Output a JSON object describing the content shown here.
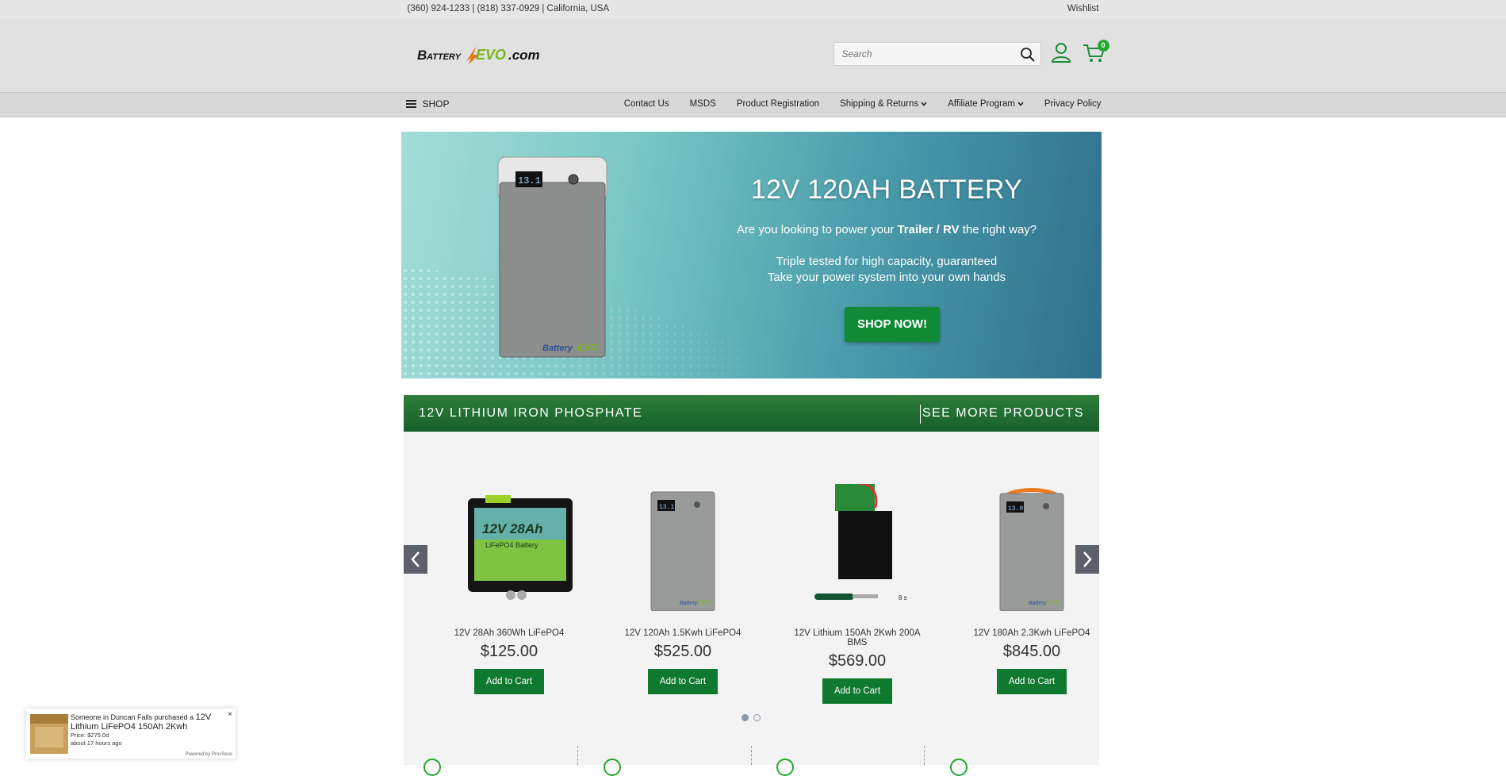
{
  "topbar": {
    "contact": "(360) 924-1233 | (818) 337-0929 | California, USA",
    "wishlist": "Wishlist"
  },
  "header": {
    "logo_text": "BatteryEVO.com",
    "search_placeholder": "Search",
    "cart_count": "0"
  },
  "nav": {
    "shop": "SHOP",
    "links": [
      "Contact Us",
      "MSDS",
      "Product Registration",
      "Shipping & Returns",
      "Affiliate Program",
      "Privacy Policy"
    ]
  },
  "hero": {
    "title": "12V 120AH BATTERY",
    "question_pre": "Are you looking to power your ",
    "question_bold": "Trailer / RV",
    "question_post": " the right way?",
    "line1": "Triple tested for high capacity, guaranteed",
    "line2": "Take your power system into your own hands",
    "button": "SHOP NOW!",
    "display": "13.1"
  },
  "section": {
    "title": "12V LITHIUM IRON PHOSPHATE",
    "more": "SEE MORE PRODUCTS"
  },
  "products": [
    {
      "name": "12V 28Ah 360Wh LiFePO4",
      "price": "$125.00",
      "button": "Add to Cart"
    },
    {
      "name": "12V 120Ah 1.5Kwh LiFePO4",
      "price": "$525.00",
      "button": "Add to Cart"
    },
    {
      "name": "12V Lithium 150Ah 2Kwh 200A BMS",
      "price": "$569.00",
      "button": "Add to Cart"
    },
    {
      "name": "12V 180Ah 2.3Kwh LiFePO4",
      "price": "$845.00",
      "button": "Add to Cart"
    }
  ],
  "popup": {
    "intro": "Someone in Duncan Falls purchased a ",
    "product": "12V Lithium LiFePO4 150Ah 2Kwh",
    "price": "Price: $275.0d",
    "time": "about 17 hours ago",
    "powered": "Powered by ProvSeus",
    "close": "×"
  },
  "colors": {
    "accent_green": "#0f7a2f",
    "header_bg": "#e1e1e1",
    "cart_badge": "#25a72f"
  }
}
